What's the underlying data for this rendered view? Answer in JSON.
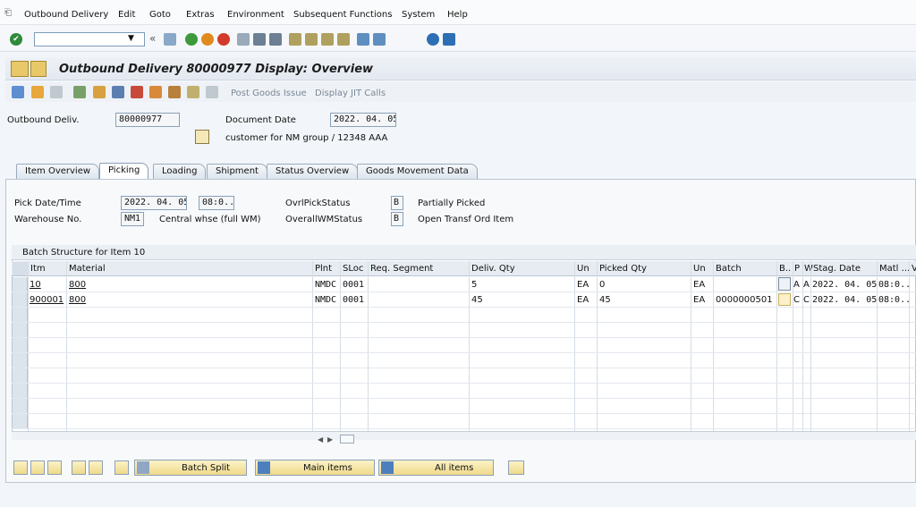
{
  "menu": {
    "items": [
      "Outbound Delivery",
      "Edit",
      "Goto",
      "Extras",
      "Environment",
      "Subsequent Functions",
      "System",
      "Help"
    ]
  },
  "window": {
    "title": "Outbound Delivery 80000977 Display: Overview"
  },
  "app_toolbar": {
    "post_goods_issue": "Post Goods Issue",
    "display_jit_calls": "Display JIT Calls"
  },
  "header": {
    "outbound_deliv_label": "Outbound Deliv.",
    "outbound_deliv_value": "80000977",
    "document_date_label": "Document Date",
    "document_date_value": "2022. 04. 05",
    "ship_to_text": "customer for NM group / 12348 AAA"
  },
  "tabs": [
    {
      "label": "Item Overview"
    },
    {
      "label": "Picking"
    },
    {
      "label": "Loading"
    },
    {
      "label": "Shipment"
    },
    {
      "label": "Status Overview"
    },
    {
      "label": "Goods Movement Data"
    }
  ],
  "picking": {
    "pick_date_label": "Pick Date/Time",
    "pick_date_value": "2022. 04. 05",
    "pick_time_value": "08:0..",
    "warehouse_label": "Warehouse No.",
    "warehouse_value": "NM1",
    "warehouse_text": "Central whse (full WM)",
    "ovrl_pick_label": "OvrlPickStatus",
    "ovrl_pick_value": "B",
    "ovrl_pick_text": "Partially Picked",
    "overall_wm_label": "OverallWMStatus",
    "overall_wm_value": "B",
    "overall_wm_text": "Open Transf Ord Item"
  },
  "table": {
    "title": "Batch Structure for Item 10",
    "columns": [
      "Itm",
      "Material",
      "Plnt",
      "SLoc",
      "Req. Segment",
      "Deliv. Qty",
      "Un",
      "Picked Qty",
      "Un",
      "Batch",
      "B..",
      "P",
      "W",
      "Stag. Date",
      "Matl ...",
      "V"
    ],
    "rows": [
      {
        "itm": "10",
        "material": "800",
        "plnt": "NMDC",
        "sloc": "0001",
        "req": "",
        "deliv_qty": "5",
        "un": "EA",
        "picked_qty": "0",
        "un2": "EA",
        "batch": "",
        "b": "",
        "p": "A",
        "w": "A",
        "stag_date": "2022. 04. 05",
        "matl": "08:0.."
      },
      {
        "itm": "900001",
        "material": "800",
        "plnt": "NMDC",
        "sloc": "0001",
        "req": "",
        "deliv_qty": "45",
        "un": "EA",
        "picked_qty": "45",
        "un2": "EA",
        "batch": "0000000501",
        "b": "",
        "p": "C",
        "w": "C",
        "stag_date": "2022. 04. 05",
        "matl": "08:0.."
      }
    ]
  },
  "bottom": {
    "batch_split": "Batch Split",
    "main_items": "Main items",
    "all_items": "All items"
  }
}
